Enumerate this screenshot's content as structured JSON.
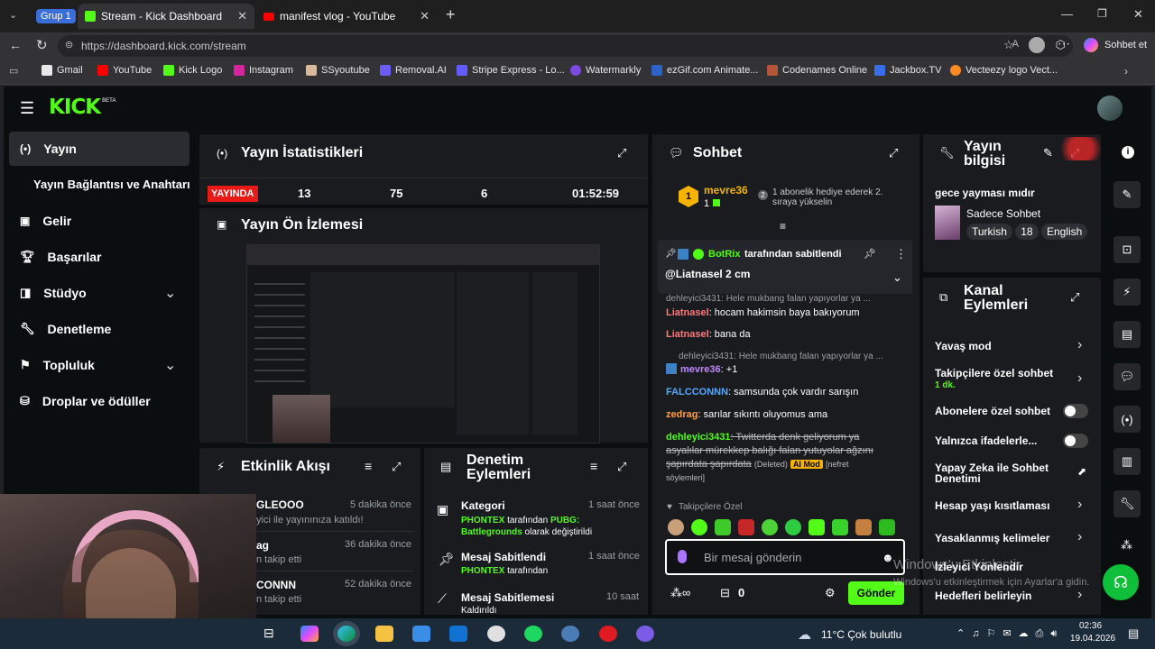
{
  "browser": {
    "group_label": "Grup 1",
    "tabs": [
      {
        "title": "Stream - Kick Dashboard"
      },
      {
        "title": "manifest vlog - YouTube"
      }
    ],
    "url": "https://dashboard.kick.com/stream",
    "copilot_label": "Sohbet et",
    "bookmarks": [
      "Gmail",
      "YouTube",
      "Kick Logo",
      "Instagram",
      "SSyoutube",
      "Removal.AI",
      "Stripe Express - Lo...",
      "Watermarkly",
      "ezGif.com Animate...",
      "Codenames Online",
      "Jackbox.TV",
      "Vecteezy logo Vect..."
    ]
  },
  "kick": {
    "logo": "KICK",
    "logo_badge": "BETA",
    "sidebar": [
      {
        "label": "Yayın",
        "icon": "broadcast-icon"
      },
      {
        "label": "Yayın Bağlantısı ve Anahtarı",
        "icon": ""
      },
      {
        "label": "Gelir",
        "icon": "wallet-icon"
      },
      {
        "label": "Başarılar",
        "icon": "trophy-icon"
      },
      {
        "label": "Stüdyo",
        "icon": "studio-icon"
      },
      {
        "label": "Denetleme",
        "icon": "wrench-icon"
      },
      {
        "label": "Topluluk",
        "icon": "community-icon"
      },
      {
        "label": "Droplar ve ödüller",
        "icon": "drops-icon"
      }
    ],
    "stats": {
      "title": "Yayın İstatistikleri",
      "live_badge": "YAYINDA",
      "values": [
        "13",
        "75",
        "6",
        "01:52:59"
      ]
    },
    "preview_title": "Yayın Ön İzlemesi",
    "activity": {
      "title": "Etkinlik Akışı",
      "items": [
        {
          "user": "GLEOOO",
          "time": "5 dakika önce",
          "desc": "yici ile yayınınıza katıldı!"
        },
        {
          "user": "ag",
          "time": "36 dakika önce",
          "desc": "n takip etti"
        },
        {
          "user": "CONNN",
          "time": "52 dakika önce",
          "desc": "n takip etti"
        }
      ]
    },
    "moderation": {
      "title_1": "Denetim",
      "title_2": "Eylemleri",
      "items": [
        {
          "title": "Kategori",
          "time": "1 saat önce",
          "line1_a": "PHONTEX",
          "line1_b": " tarafından ",
          "line1_c": "PUBG:",
          "line2_a": "Battlegrounds",
          "line2_b": " olarak değiştirildi"
        },
        {
          "title": "Mesaj Sabitlendi",
          "time": "1 saat önce",
          "line1_a": "PHONTEX",
          "line1_b": " tarafından"
        },
        {
          "title": "Mesaj Sabitlemesi",
          "time": "10 saat",
          "line1_a": "Kaldırıldı"
        }
      ]
    },
    "chat": {
      "title": "Sohbet",
      "top_user": "mevre36",
      "top_count": "1",
      "sub_rank": "2",
      "sub_msg_1": "1 abonelik hediye ederek 2.",
      "sub_msg_2": "sıraya yükselin",
      "pinned_by": "BotRix",
      "pinned_suffix": "tarafından sabitlendi",
      "pinned_msg": "@Liatnasel 2 cm",
      "messages": [
        {
          "reply": "dehleyici3431: Hele mukbang falan yapıyorlar ya ...",
          "user": "Liatnasel",
          "text": ": hocam hakimsin baya bakıyorum"
        },
        {
          "user": "Liatnasel",
          "text": ": bana da"
        },
        {
          "reply": "dehleyici3431: Hele mukbang falan yapıyorlar ya ...",
          "user": "mevre36",
          "text": ": +1"
        },
        {
          "user": "FALCCONNN",
          "text": ": samsunda çok vardır sarışın"
        },
        {
          "user": "zedrag",
          "text": ": sarılar sıkıntı oluyomus ama"
        },
        {
          "user": "dehleyici3431",
          "text": ": Twitterda denk geliyorum ya",
          "text2": "asyalılar mürekkep balığı falan yutuyolar ağzını",
          "text3": "şapırdata şapırdata",
          "deleted": "(Deleted)",
          "ai_mod": "AI Mod",
          "reason": "[nefret",
          "reason2": "söylemleri]"
        }
      ],
      "followers_only": "Takipçilere Özel",
      "input_placeholder": "Bir mesaj gönderin",
      "points": "0",
      "send_label": "Gönder"
    },
    "stream_info": {
      "title_1": "Yayın",
      "title_2": "bilgisi",
      "stream_title": "gece yayması mıdır",
      "category": "Sadece Sohbet",
      "tags": [
        "Turkish",
        "18",
        "English"
      ]
    },
    "channel_actions": {
      "title_1": "Kanal",
      "title_2": "Eylemleri",
      "items": [
        {
          "label": "Yavaş mod",
          "control": "chevron"
        },
        {
          "label": "Takipçilere özel sohbet",
          "sub": "1 dk.",
          "control": "chevron"
        },
        {
          "label": "Abonelere özel sohbet",
          "control": "toggle"
        },
        {
          "label": "Yalnızca ifadelerle...",
          "control": "toggle"
        },
        {
          "label": "Yapay Zeka ile Sohbet",
          "label2": "Denetimi",
          "control": "external"
        },
        {
          "label": "Hesap yaşı kısıtlaması",
          "control": "chevron"
        },
        {
          "label": "Yasaklanmış kelimeler",
          "control": "chevron"
        },
        {
          "label": "İzleyici Yönlendir",
          "control": "none"
        },
        {
          "label": "Hedefleri belirleyin",
          "control": "chevron"
        }
      ]
    }
  },
  "windows_watermark": {
    "line1": "Windows'u Etkinleştir",
    "line2": "Windows'u etkinleştirmek için Ayarlar'a gidin."
  },
  "taskbar": {
    "weather": "11°C  Çok bulutlu",
    "time": "02:36",
    "date": "19.04.2026"
  }
}
